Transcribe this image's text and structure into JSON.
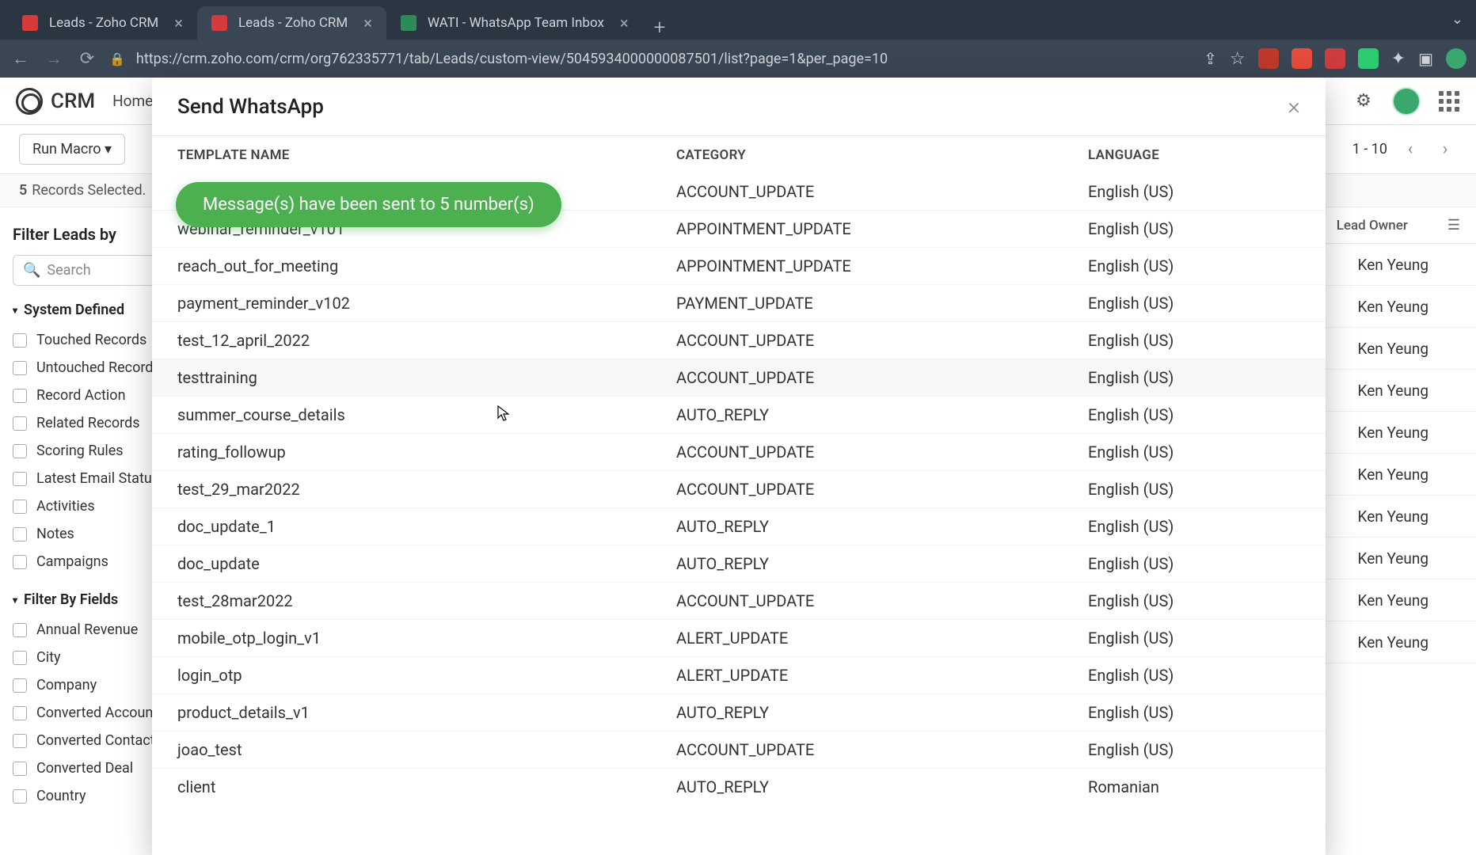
{
  "browser": {
    "tabs": [
      {
        "title": "Leads - Zoho CRM",
        "active": false,
        "fav": "z"
      },
      {
        "title": "Leads - Zoho CRM",
        "active": true,
        "fav": "z"
      },
      {
        "title": "WATI - WhatsApp Team Inbox",
        "active": false,
        "fav": "w"
      }
    ],
    "url": "https://crm.zoho.com/crm/org762335771/tab/Leads/custom-view/5045934000000087501/list?page=1&per_page=10"
  },
  "header": {
    "brand": "CRM",
    "nav_home": "Home"
  },
  "toolbar": {
    "run_macro": "Run Macro ▾",
    "pager": "1 - 10"
  },
  "records_bar": "5  Records Selected.",
  "sidebar": {
    "title": "Filter Leads by",
    "search_placeholder": "Search",
    "section1": "System Defined",
    "filters1": [
      "Touched Records",
      "Untouched Records",
      "Record Action",
      "Related Records",
      "Scoring Rules",
      "Latest Email Status",
      "Activities",
      "Notes",
      "Campaigns"
    ],
    "section2": "Filter By Fields",
    "filters2": [
      "Annual Revenue",
      "City",
      "Company",
      "Converted Account",
      "Converted Contact",
      "Converted Deal",
      "Country"
    ]
  },
  "table": {
    "col_owner": "Lead Owner",
    "rows": [
      {
        "owner": "Ken Yeung"
      },
      {
        "owner": "Ken Yeung"
      },
      {
        "owner": "Ken Yeung"
      },
      {
        "owner": "Ken Yeung"
      },
      {
        "owner": "Ken Yeung"
      },
      {
        "owner": "Ken Yeung"
      },
      {
        "owner": "Ken Yeung"
      },
      {
        "owner": "Ken Yeung"
      },
      {
        "owner": "Ken Yeung"
      },
      {
        "owner": "Ken Yeung"
      }
    ]
  },
  "modal": {
    "title": "Send WhatsApp",
    "col_name": "TEMPLATE NAME",
    "col_cat": "CATEGORY",
    "col_lang": "LANGUAGE",
    "templates": [
      {
        "name": "",
        "category": "ACCOUNT_UPDATE",
        "language": "English (US)"
      },
      {
        "name": "webinar_reminder_v101",
        "category": "APPOINTMENT_UPDATE",
        "language": "English (US)"
      },
      {
        "name": "reach_out_for_meeting",
        "category": "APPOINTMENT_UPDATE",
        "language": "English (US)"
      },
      {
        "name": "payment_reminder_v102",
        "category": "PAYMENT_UPDATE",
        "language": "English (US)"
      },
      {
        "name": "test_12_april_2022",
        "category": "ACCOUNT_UPDATE",
        "language": "English (US)"
      },
      {
        "name": "testtraining",
        "category": "ACCOUNT_UPDATE",
        "language": "English (US)"
      },
      {
        "name": "summer_course_details",
        "category": "AUTO_REPLY",
        "language": "English (US)"
      },
      {
        "name": "rating_followup",
        "category": "ACCOUNT_UPDATE",
        "language": "English (US)"
      },
      {
        "name": "test_29_mar2022",
        "category": "ACCOUNT_UPDATE",
        "language": "English (US)"
      },
      {
        "name": "doc_update_1",
        "category": "AUTO_REPLY",
        "language": "English (US)"
      },
      {
        "name": "doc_update",
        "category": "AUTO_REPLY",
        "language": "English (US)"
      },
      {
        "name": "test_28mar2022",
        "category": "ACCOUNT_UPDATE",
        "language": "English (US)"
      },
      {
        "name": "mobile_otp_login_v1",
        "category": "ALERT_UPDATE",
        "language": "English (US)"
      },
      {
        "name": "login_otp",
        "category": "ALERT_UPDATE",
        "language": "English (US)"
      },
      {
        "name": "product_details_v1",
        "category": "AUTO_REPLY",
        "language": "English (US)"
      },
      {
        "name": "joao_test",
        "category": "ACCOUNT_UPDATE",
        "language": "English (US)"
      },
      {
        "name": "client",
        "category": "AUTO_REPLY",
        "language": "Romanian"
      }
    ]
  },
  "toast": "Message(s) have been sent to 5 number(s)"
}
